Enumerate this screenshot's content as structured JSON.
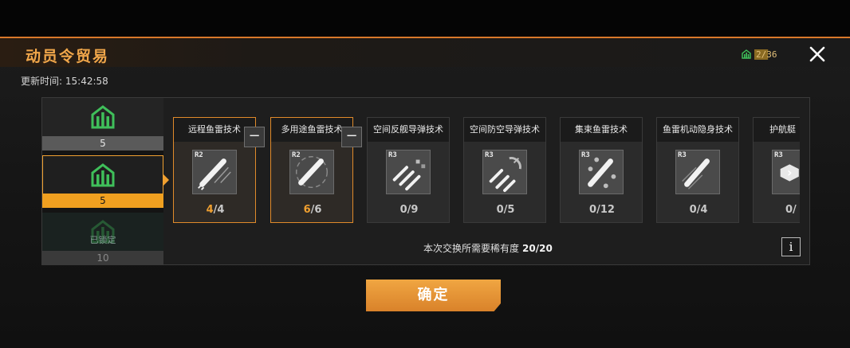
{
  "header": {
    "title": "动员令贸易",
    "currency_value": "2/36",
    "update_label": "更新时间:",
    "update_time": "15:42:58"
  },
  "tiers": [
    {
      "count": "5",
      "state": "normal"
    },
    {
      "count": "5",
      "state": "selected"
    },
    {
      "count": "10",
      "state": "locked",
      "locked_label": "已锁定"
    }
  ],
  "items": [
    {
      "name": "远程鱼雷技术",
      "rank": "R2",
      "have": "4",
      "need": "4",
      "active": true,
      "has_minus": true
    },
    {
      "name": "多用途鱼雷技术",
      "rank": "R2",
      "have": "6",
      "need": "6",
      "active": true,
      "has_minus": true
    },
    {
      "name": "空间反舰导弹技术",
      "rank": "R3",
      "have": "0",
      "need": "9",
      "active": false,
      "has_minus": false
    },
    {
      "name": "空间防空导弹技术",
      "rank": "R3",
      "have": "0",
      "need": "5",
      "active": false,
      "has_minus": false
    },
    {
      "name": "集束鱼雷技术",
      "rank": "R3",
      "have": "0",
      "need": "12",
      "active": false,
      "has_minus": false
    },
    {
      "name": "鱼雷机动隐身技术",
      "rank": "R3",
      "have": "0",
      "need": "4",
      "active": false,
      "has_minus": false
    },
    {
      "name": "护航艇",
      "rank": "R3",
      "have": "0",
      "need": "",
      "active": false,
      "has_minus": false
    }
  ],
  "rarity": {
    "label": "本次交换所需要稀有度",
    "value": "20/20"
  },
  "buttons": {
    "minus": "−",
    "info": "i",
    "confirm": "确定"
  },
  "colors": {
    "accent": "#f0a030",
    "title": "#f0a64a",
    "icon_green": "#3fbf5a"
  }
}
